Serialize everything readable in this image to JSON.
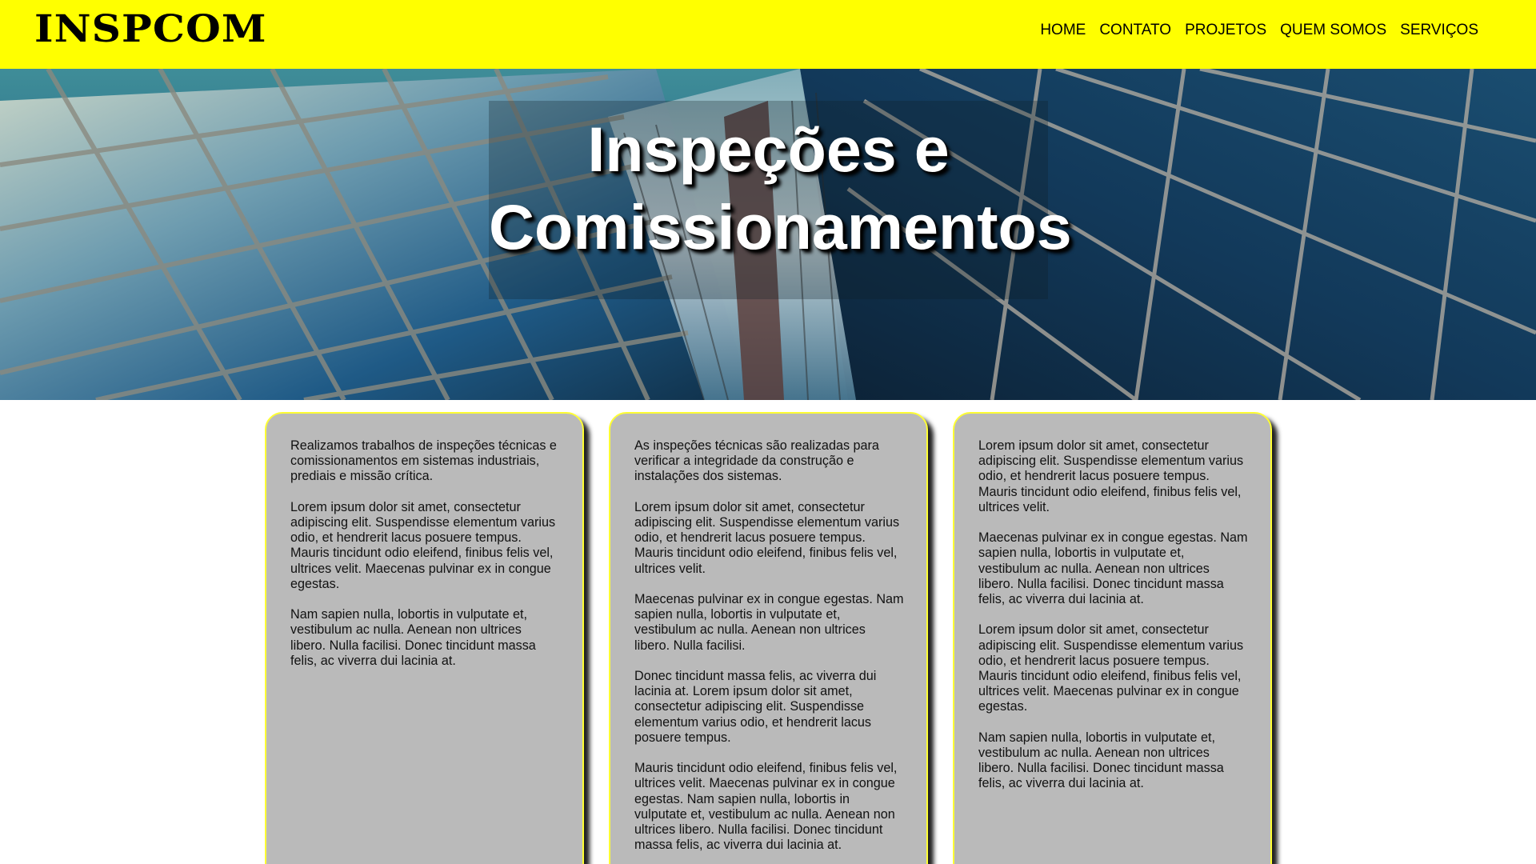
{
  "header": {
    "logo": "INSPCOM",
    "nav": [
      "HOME",
      "CONTATO",
      "PROJETOS",
      "QUEM SOMOS",
      "SERVIÇOS"
    ]
  },
  "hero": {
    "title_line1": "Inspeções e",
    "title_line2": "Comissionamentos"
  },
  "cards": [
    {
      "paragraphs": [
        "Realizamos trabalhos de inspeções técnicas e comissionamentos em sistemas industriais, prediais e missão crítica.",
        "Lorem ipsum dolor sit amet, consectetur adipiscing elit. Suspendisse elementum varius odio, et hendrerit lacus posuere tempus. Mauris tincidunt odio eleifend, finibus felis vel, ultrices velit. Maecenas pulvinar ex in congue egestas.",
        "Nam sapien nulla, lobortis in vulputate et, vestibulum ac nulla. Aenean non ultrices libero. Nulla facilisi. Donec tincidunt massa felis, ac viverra dui lacinia at."
      ]
    },
    {
      "paragraphs": [
        "As inspeções técnicas são realizadas para verificar a integridade da construção e instalações dos sistemas.",
        "Lorem ipsum dolor sit amet, consectetur adipiscing elit. Suspendisse elementum varius odio, et hendrerit lacus posuere tempus. Mauris tincidunt odio eleifend, finibus felis vel, ultrices velit.",
        "Maecenas pulvinar ex in congue egestas. Nam sapien nulla, lobortis in vulputate et, vestibulum ac nulla. Aenean non ultrices libero. Nulla facilisi.",
        "Donec tincidunt massa felis, ac viverra dui lacinia at. Lorem ipsum dolor sit amet, consectetur adipiscing elit. Suspendisse elementum varius odio, et hendrerit lacus posuere tempus.",
        "Mauris tincidunt odio eleifend, finibus felis vel, ultrices velit. Maecenas pulvinar ex in congue egestas. Nam sapien nulla, lobortis in vulputate et, vestibulum ac nulla. Aenean non ultrices libero. Nulla facilisi. Donec tincidunt massa felis, ac viverra dui lacinia at."
      ]
    },
    {
      "paragraphs": [
        "Lorem ipsum dolor sit amet, consectetur adipiscing elit. Suspendisse elementum varius odio, et hendrerit lacus posuere tempus. Mauris tincidunt odio eleifend, finibus felis vel, ultrices velit.",
        "Maecenas pulvinar ex in congue egestas. Nam sapien nulla, lobortis in vulputate et, vestibulum ac nulla. Aenean non ultrices libero. Nulla facilisi. Donec tincidunt massa felis, ac viverra dui lacinia at.",
        "Lorem ipsum dolor sit amet, consectetur adipiscing elit. Suspendisse elementum varius odio, et hendrerit lacus posuere tempus. Mauris tincidunt odio eleifend, finibus felis vel, ultrices velit. Maecenas pulvinar ex in congue egestas.",
        "Nam sapien nulla, lobortis in vulputate et, vestibulum ac nulla. Aenean non ultrices libero. Nulla facilisi. Donec tincidunt massa felis, ac viverra dui lacinia at."
      ]
    }
  ]
}
